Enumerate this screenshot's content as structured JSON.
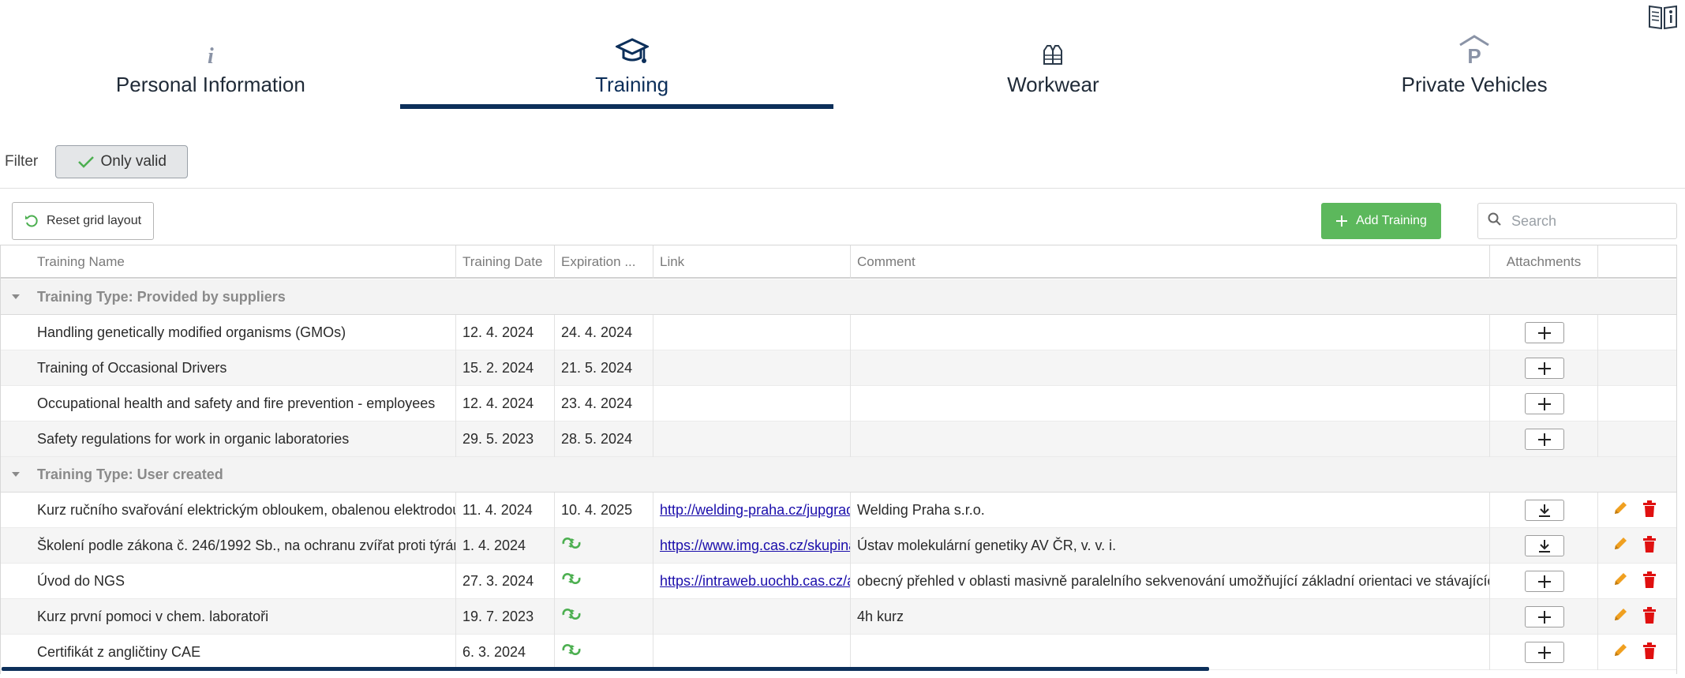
{
  "header": {
    "manual_icon": "manual-book-icon"
  },
  "tabs": [
    {
      "label": "Personal Information",
      "icon": "info-icon",
      "icon_text": "i",
      "active": false
    },
    {
      "label": "Training",
      "icon": "graduation-cap-icon",
      "active": true
    },
    {
      "label": "Workwear",
      "icon": "vest-icon",
      "active": false
    },
    {
      "label": "Private Vehicles",
      "icon": "parking-icon",
      "icon_text": "P",
      "active": false
    }
  ],
  "filter": {
    "label": "Filter",
    "only_valid_label": "Only valid",
    "only_valid_checked": true
  },
  "toolbar": {
    "reset_label": "Reset grid layout",
    "add_label": "Add Training",
    "search_placeholder": "Search"
  },
  "grid": {
    "columns": [
      "Training Name",
      "Training Date",
      "Expiration ...",
      "Link",
      "Comment",
      "Attachments",
      ""
    ],
    "groups": [
      {
        "label": "Training Type: Provided by suppliers",
        "rows": [
          {
            "name": "Handling genetically modified organisms (GMOs)",
            "date": "12. 4. 2024",
            "expiration": "24. 4. 2024",
            "link": "",
            "comment": "",
            "attachment": "add"
          },
          {
            "name": "Training of Occasional Drivers",
            "date": "15. 2. 2024",
            "expiration": "21. 5. 2024",
            "link": "",
            "comment": "",
            "attachment": "add"
          },
          {
            "name": "Occupational health and safety and fire prevention - employees",
            "date": "12. 4. 2024",
            "expiration": "23. 4. 2024",
            "link": "",
            "comment": "",
            "attachment": "add"
          },
          {
            "name": "Safety regulations for work in organic laboratories",
            "date": "29. 5. 2023",
            "expiration": "28. 5. 2024",
            "link": "",
            "comment": "",
            "attachment": "add"
          }
        ]
      },
      {
        "label": "Training Type: User created",
        "rows": [
          {
            "name": "Kurz ručního svařování elektrickým obloukem, obalenou elektrodou",
            "date": "11. 4. 2024",
            "expiration": "10. 4. 2025",
            "link": "http://welding-praha.cz/jupgrad",
            "comment": "Welding Praha s.r.o.",
            "attachment": "download"
          },
          {
            "name": "Školení podle zákona č. 246/1992 Sb., na ochranu zvířat proti týrání",
            "date": "1. 4. 2024",
            "expiration": "",
            "renewal_icon": "renewal-icon",
            "link": "https://www.img.cas.cz/skupina",
            "comment": "Ústav molekulární genetiky AV ČR, v. v. i.",
            "attachment": "download"
          },
          {
            "name": "Úvod do NGS",
            "date": "27. 3. 2024",
            "expiration": "",
            "renewal_icon": "renewal-icon",
            "link": "https://intraweb.uochb.cas.cz/a",
            "comment": "obecný přehled v oblasti masivně paralelního sekvenování umožňující základní orientaci ve stávajících te",
            "attachment": "add"
          },
          {
            "name": "Kurz první pomoci v chem. laboratoři",
            "date": "19. 7. 2023",
            "expiration": "",
            "renewal_icon": "renewal-icon",
            "link": "",
            "comment": "4h kurz",
            "attachment": "add"
          },
          {
            "name": "Certifikát z angličtiny CAE",
            "date": "6. 3. 2024",
            "expiration": "",
            "renewal_icon": "renewal-icon",
            "link": "",
            "comment": "",
            "attachment": "add"
          }
        ]
      }
    ]
  },
  "colors": {
    "accent": "#0c2f5a",
    "add_button": "#5cb85c",
    "edit": "#f0a020",
    "delete": "#e01010",
    "renewal": "#4caf50"
  }
}
